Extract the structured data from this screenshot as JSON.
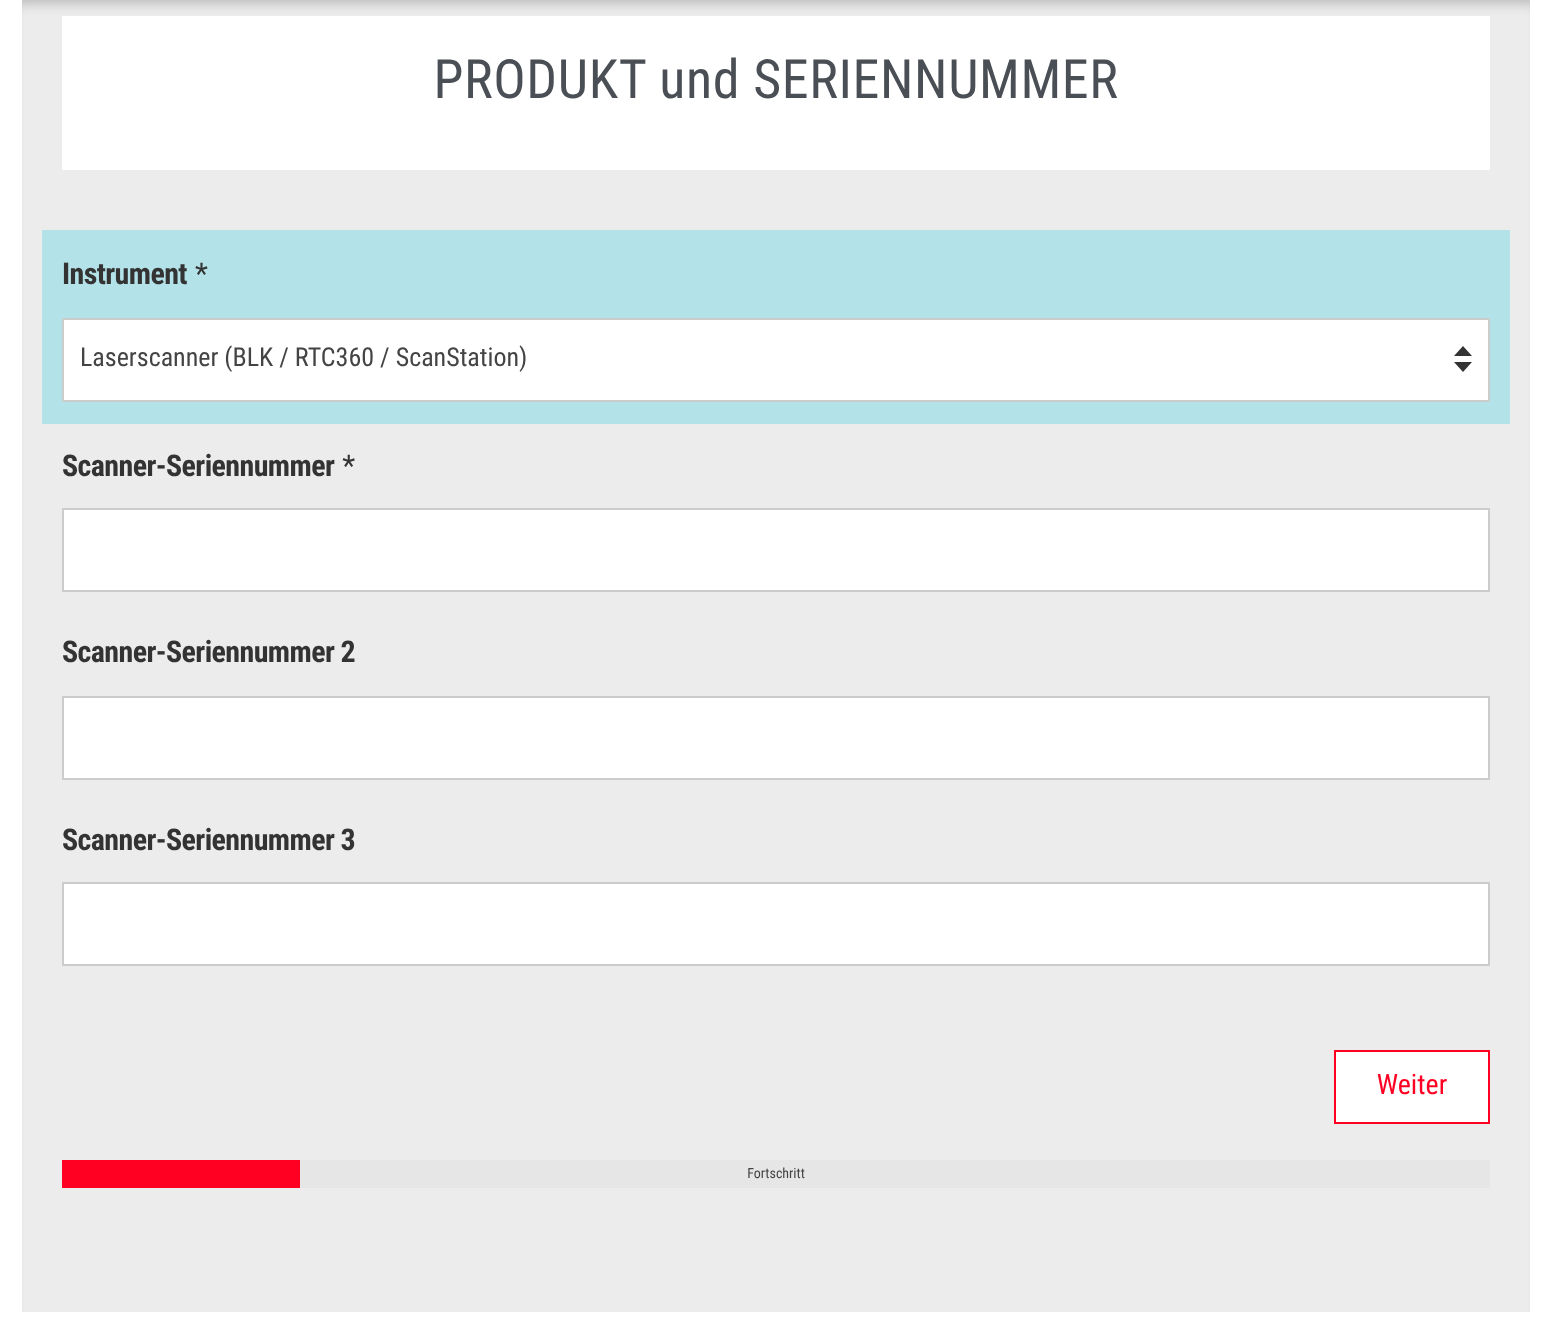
{
  "title": "PRODUKT und SERIENNUMMER",
  "fields": [
    {
      "kind": "select",
      "label": "Instrument",
      "required_mark": "*",
      "highlighted": true,
      "value": "Laserscanner (BLK / RTC360 / ScanStation)"
    },
    {
      "kind": "text",
      "label": "Scanner-Seriennummer",
      "required_mark": "*",
      "highlighted": false
    },
    {
      "kind": "text",
      "label": "Scanner-Seriennummer 2",
      "highlighted": false
    },
    {
      "kind": "text",
      "label": "Scanner-Seriennummer 3",
      "highlighted": false
    }
  ],
  "button": "Weiter",
  "progress": {
    "label": "Fortschritt",
    "level": 0.166
  }
}
